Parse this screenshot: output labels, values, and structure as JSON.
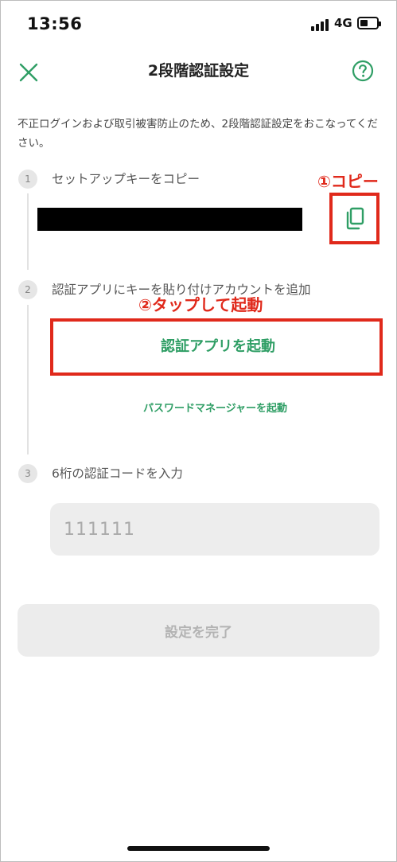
{
  "status_bar": {
    "time": "13:56",
    "network": "4G",
    "battery_level": 0.45
  },
  "header": {
    "title": "2段階認証設定",
    "close_icon": "close-icon",
    "help_icon": "help-circle-icon"
  },
  "intro_text": "不正ログインおよび取引被害防止のため、2段階認証設定をおこなってください。",
  "steps": [
    {
      "number": "1",
      "label": "セットアップキーをコピー"
    },
    {
      "number": "2",
      "label": "認証アプリにキーを貼り付けアカウントを追加"
    },
    {
      "number": "3",
      "label": "6桁の認証コードを入力"
    }
  ],
  "copy_icon": "copy-icon",
  "annotations": {
    "copy": "①コピー",
    "launch": "②タップして起動"
  },
  "buttons": {
    "launch_auth_app": "認証アプリを起動",
    "launch_password_manager": "パスワードマネージャーを起動",
    "complete": "設定を完了"
  },
  "code_input": {
    "placeholder": "111111",
    "value": ""
  },
  "colors": {
    "accent": "#2f9e65",
    "annotation": "#e0291b",
    "disabled": "#ececec"
  }
}
